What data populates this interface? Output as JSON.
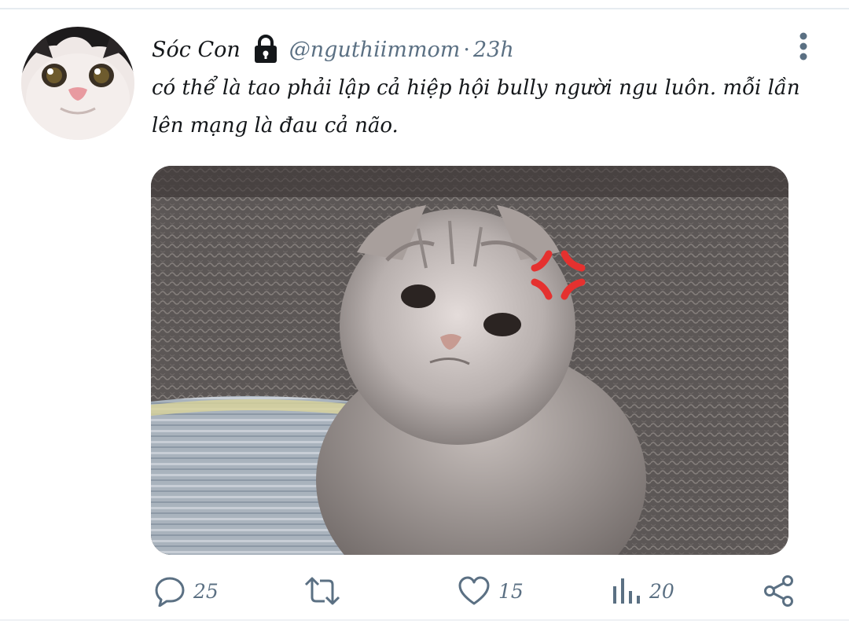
{
  "tweet": {
    "display_name": "Sóc Con",
    "handle": "@nguthiimmom",
    "separator": "·",
    "time": "23h",
    "text": "có thể là tao phải lập cả hiệp hội bully người ngu luôn. mỗi lần lên mạng là đau cả não.",
    "icons": {
      "lock": "lock-icon",
      "more": "more-vertical-icon",
      "reply": "reply-icon",
      "retweet": "retweet-icon",
      "like": "heart-icon",
      "views": "views-chart-icon",
      "share": "share-icon",
      "anger": "anger-symbol-icon"
    }
  },
  "actions": {
    "reply_count": "25",
    "retweet_count": "",
    "like_count": "15",
    "view_count": "20"
  },
  "colors": {
    "text": "#14171a",
    "muted": "#5b7083",
    "anger": "#e5312f",
    "divider": "#e6ecf0"
  }
}
